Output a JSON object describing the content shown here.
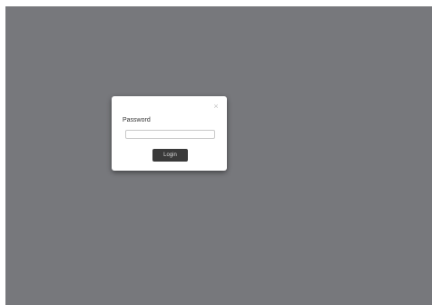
{
  "dialog": {
    "close_glyph": "×",
    "password_label": "Password",
    "password_value": "",
    "password_placeholder": "",
    "login_label": "Login"
  },
  "colors": {
    "overlay": "#77787c",
    "button": "#3a3a3a",
    "button_text": "#d8d8d8"
  }
}
